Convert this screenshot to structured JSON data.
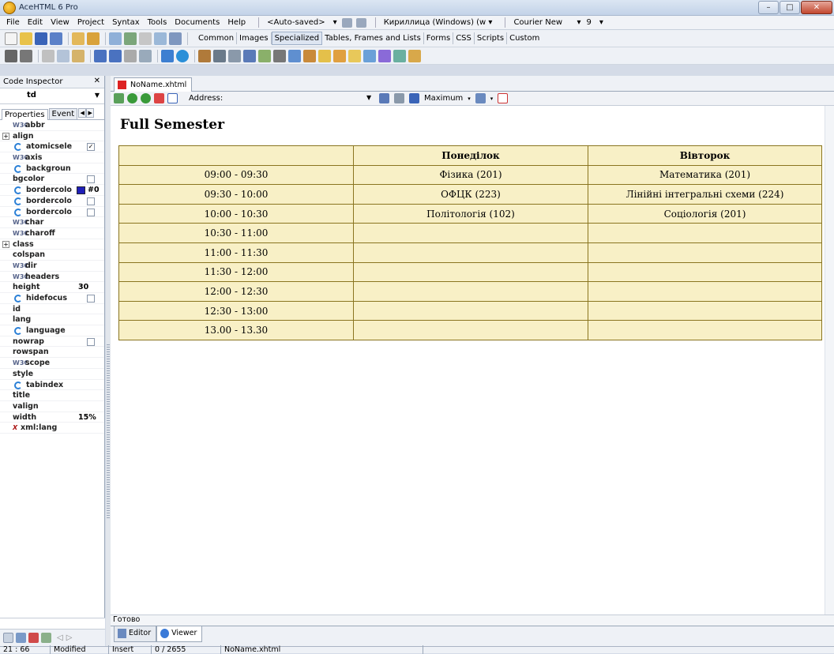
{
  "window": {
    "title": "AceHTML 6 Pro",
    "min": "–",
    "max": "□",
    "close": "✕"
  },
  "menu": {
    "items": [
      "File",
      "Edit",
      "View",
      "Project",
      "Syntax",
      "Tools",
      "Documents",
      "Help"
    ],
    "autosave": "<Auto-saved>",
    "encoding": "Кириллица (Windows) (w ▾",
    "font": "Courier New",
    "font_size": "9",
    "dd_arrow": "▾"
  },
  "toolbar_tabs": [
    "Common",
    "Images",
    "Specialized",
    "Tables, Frames and Lists",
    "Forms",
    "CSS",
    "Scripts",
    "Custom"
  ],
  "code_inspector": {
    "title": "Code Inspector",
    "close": "✕",
    "tag": "td",
    "tabs": [
      "Properties",
      "Event"
    ],
    "props": [
      {
        "icon": "w3c",
        "name": "abbr"
      },
      {
        "icon": "expand",
        "name": "align"
      },
      {
        "icon": "ie",
        "name": "atomicsele",
        "check": "checked"
      },
      {
        "icon": "w3c",
        "name": "axis"
      },
      {
        "icon": "ie",
        "name": "backgroun"
      },
      {
        "icon": "none",
        "name": "bgcolor",
        "check": "empty"
      },
      {
        "icon": "ie",
        "name": "bordercolo",
        "swatch": "#0"
      },
      {
        "icon": "ie",
        "name": "bordercolo",
        "check": "empty"
      },
      {
        "icon": "ie",
        "name": "bordercolo",
        "check": "empty"
      },
      {
        "icon": "w3c",
        "name": "char"
      },
      {
        "icon": "w3c",
        "name": "charoff"
      },
      {
        "icon": "expand",
        "name": "class"
      },
      {
        "icon": "none",
        "name": "colspan"
      },
      {
        "icon": "w3c",
        "name": "dir"
      },
      {
        "icon": "w3c",
        "name": "headers"
      },
      {
        "icon": "none",
        "name": "height",
        "value": "30"
      },
      {
        "icon": "ie",
        "name": "hidefocus",
        "check": "empty"
      },
      {
        "icon": "none",
        "name": "id"
      },
      {
        "icon": "none",
        "name": "lang"
      },
      {
        "icon": "ie",
        "name": "language"
      },
      {
        "icon": "none",
        "name": "nowrap",
        "check": "empty"
      },
      {
        "icon": "none",
        "name": "rowspan"
      },
      {
        "icon": "w3c",
        "name": "scope"
      },
      {
        "icon": "none",
        "name": "style"
      },
      {
        "icon": "ie",
        "name": "tabindex"
      },
      {
        "icon": "none",
        "name": "title"
      },
      {
        "icon": "none",
        "name": "valign"
      },
      {
        "icon": "none",
        "name": "width",
        "value": "15%"
      },
      {
        "icon": "x",
        "name": "xml:lang"
      }
    ]
  },
  "document": {
    "tab": "NoName.xhtml",
    "address_label": "Address:",
    "maximum_label": "Maximum",
    "page_title": "Full Semester",
    "table": {
      "headers": [
        "",
        "Понеділок",
        "Вівторок"
      ],
      "rows": [
        [
          "09:00 - 09:30",
          "Фізика (201)",
          "Математика (201)"
        ],
        [
          "09:30 - 10:00",
          "ОФЦК (223)",
          "Лінійні інтегральні схеми (224)"
        ],
        [
          "10:00 - 10:30",
          "Політологія (102)",
          "Соціологія (201)"
        ],
        [
          "10:30 - 11:00",
          "",
          ""
        ],
        [
          "11:00 - 11:30",
          "",
          ""
        ],
        [
          "11:30 - 12:00",
          "",
          ""
        ],
        [
          "12:00 - 12:30",
          "",
          ""
        ],
        [
          "12:30 - 13:00",
          "",
          ""
        ],
        [
          "13.00 - 13.30",
          "",
          ""
        ]
      ]
    },
    "status_text": "Готово",
    "bottom_tabs": [
      "Editor",
      "Viewer"
    ]
  },
  "statusbar": {
    "position": "21 : 66",
    "modified": "Modified",
    "mode": "Insert",
    "chars": "0 / 2655",
    "file": "NoName.xhtml"
  }
}
